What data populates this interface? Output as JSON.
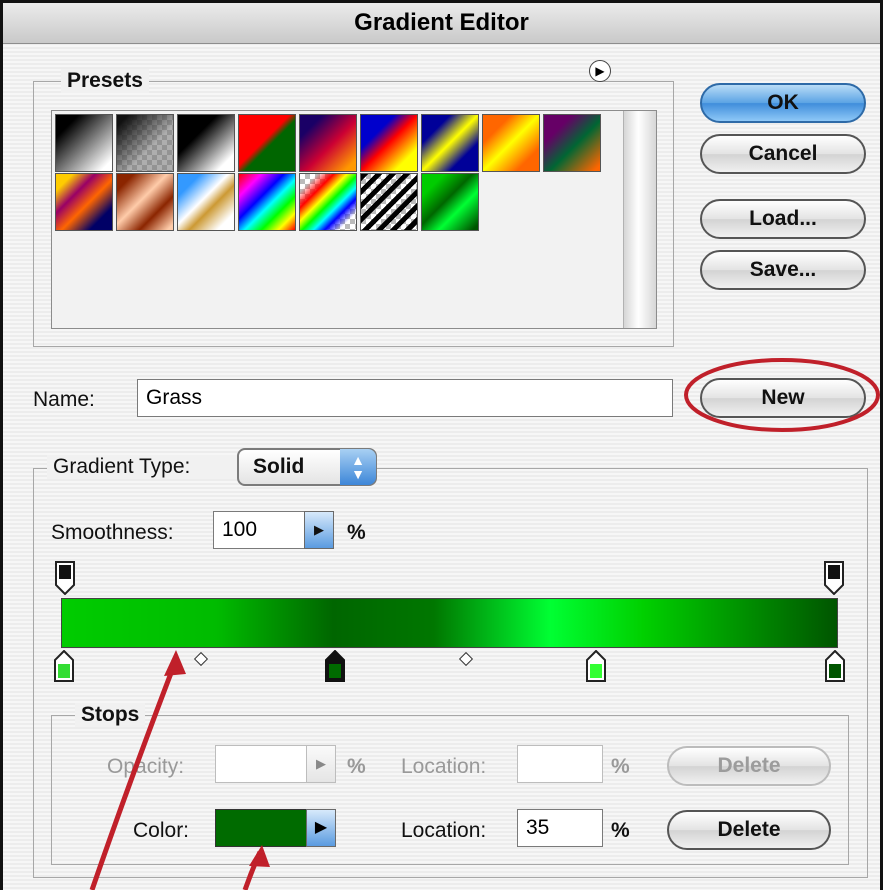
{
  "window": {
    "title": "Gradient Editor"
  },
  "presets": {
    "label": "Presets",
    "swatches": [
      {
        "name": "foreground-to-background",
        "bg": "linear-gradient(135deg,#000 20%,#fff 90%)"
      },
      {
        "name": "foreground-to-transparent",
        "bg": "linear-gradient(135deg,#111 10%,rgba(120,120,120,0.6) 60%), repeating-conic-gradient(#bbb 0% 25%, #fff 0% 50%) 0 0/10px 10px"
      },
      {
        "name": "black-white",
        "bg": "linear-gradient(135deg,#000 35%,#fff 85%)"
      },
      {
        "name": "red-green",
        "bg": "linear-gradient(135deg,#ff0000 45%,#006600 55%)"
      },
      {
        "name": "violet-orange",
        "bg": "linear-gradient(135deg,#1a0066 20%,#cc0033 55%,#ff9900 90%)"
      },
      {
        "name": "blue-red-yellow",
        "bg": "linear-gradient(135deg,#0000cc 30%,#ff0000 50%,#ffff00 80%)"
      },
      {
        "name": "blue-yellow-blue",
        "bg": "linear-gradient(135deg,#000099 25%,#ffff00 50%,#000099 75%)"
      },
      {
        "name": "orange-yellow-orange",
        "bg": "linear-gradient(135deg,#ff6600 25%,#ffff00 50%,#ff6600 80%)"
      },
      {
        "name": "violet-green-orange",
        "bg": "linear-gradient(135deg,#660066 25%,#006633 55%,#ff6600 95%)"
      },
      {
        "name": "yellow-violet-orange-blue",
        "bg": "linear-gradient(135deg,#ffcc00 15%,#990066 35%,#ff6600 55%,#000066 80%)"
      },
      {
        "name": "copper",
        "bg": "linear-gradient(135deg,#8b2500 15%,#ffccaa 45%,#8b2500 70%,#ffccaa 95%)"
      },
      {
        "name": "chrome",
        "bg": "linear-gradient(135deg,#3399ff 20%,#ffffff 45%,#cc9933 60%,#ffffff 85%)"
      },
      {
        "name": "spectrum",
        "bg": "linear-gradient(135deg,#ff0000,#ff00ff 20%,#0000ff 40%,#00ffff 55%,#00ff00 70%,#ffff00 85%,#ff0000)"
      },
      {
        "name": "transparent-rainbow",
        "bg": "linear-gradient(135deg,transparent 15%,#ff0000 30%,#ffff00 42%,#00ff00 52%,#00ffff 62%,#0000ff 72%,transparent 85%), repeating-conic-gradient(#bbb 0% 25%, #fff 0% 50%) 0 0/10px 10px"
      },
      {
        "name": "transparent-stripes",
        "bg": "repeating-linear-gradient(135deg,#000 0 5px,transparent 5px 10px), repeating-conic-gradient(#bbb 0% 25%, #fff 0% 50%) 0 0/10px 10px"
      },
      {
        "name": "grass",
        "bg": "linear-gradient(135deg,#00cc00 20%,#006600 45%,#00ff33 65%,#005500 95%)"
      }
    ]
  },
  "buttons": {
    "ok": "OK",
    "cancel": "Cancel",
    "load": "Load...",
    "save": "Save...",
    "new": "New",
    "delete_opacity": "Delete",
    "delete_color": "Delete"
  },
  "name_field": {
    "label": "Name:",
    "value": "Grass"
  },
  "gradient_type": {
    "label": "Gradient Type:",
    "value": "Solid"
  },
  "smoothness": {
    "label": "Smoothness:",
    "value": "100",
    "unit": "%"
  },
  "stops": {
    "label": "Stops",
    "opacity_label": "Opacity:",
    "opacity_value": "",
    "opacity_unit": "%",
    "opacity_location_label": "Location:",
    "opacity_location_value": "",
    "opacity_location_unit": "%",
    "color_label": "Color:",
    "color_value": "#006b00",
    "color_location_label": "Location:",
    "color_location_value": "35",
    "color_location_unit": "%"
  },
  "colors": {
    "accent_blue": "#3f8ddb",
    "annotation_red": "#c0202a"
  }
}
